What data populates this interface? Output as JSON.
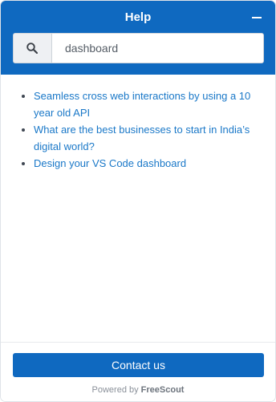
{
  "header": {
    "title": "Help",
    "minimize_icon": "minus-icon"
  },
  "search": {
    "icon": "search-icon",
    "value": "dashboard",
    "placeholder": ""
  },
  "results": [
    {
      "title": "Seamless cross web interactions by using a 10 year old API"
    },
    {
      "title": "What are the best businesses to start in India’s digital world?"
    },
    {
      "title": "Design your VS Code dashboard"
    }
  ],
  "footer": {
    "contact_label": "Contact us",
    "powered_prefix": "Powered by",
    "powered_brand": "FreeScout"
  },
  "colors": {
    "accent": "#0f69c0",
    "link": "#1a78c8"
  }
}
